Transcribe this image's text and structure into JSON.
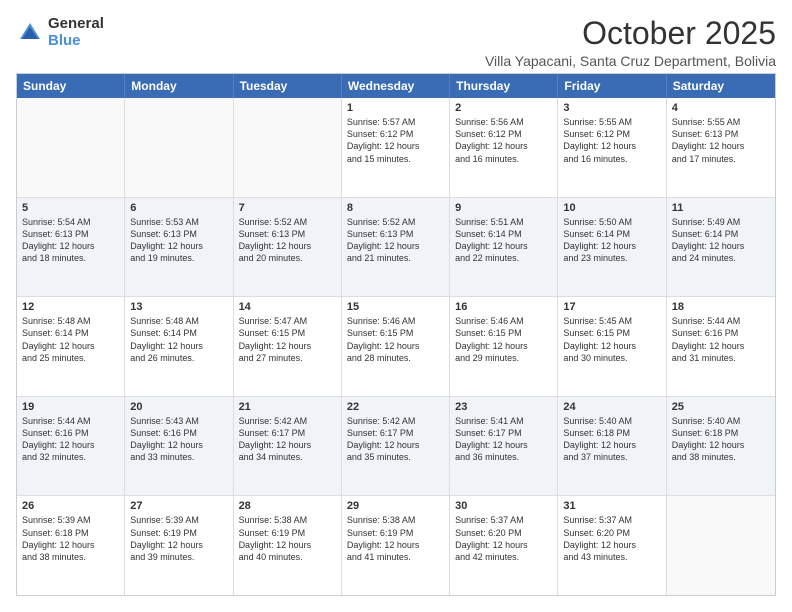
{
  "logo": {
    "general": "General",
    "blue": "Blue"
  },
  "title": "October 2025",
  "location": "Villa Yapacani, Santa Cruz Department, Bolivia",
  "headers": [
    "Sunday",
    "Monday",
    "Tuesday",
    "Wednesday",
    "Thursday",
    "Friday",
    "Saturday"
  ],
  "rows": [
    [
      {
        "day": "",
        "detail": ""
      },
      {
        "day": "",
        "detail": ""
      },
      {
        "day": "",
        "detail": ""
      },
      {
        "day": "1",
        "detail": "Sunrise: 5:57 AM\nSunset: 6:12 PM\nDaylight: 12 hours\nand 15 minutes."
      },
      {
        "day": "2",
        "detail": "Sunrise: 5:56 AM\nSunset: 6:12 PM\nDaylight: 12 hours\nand 16 minutes."
      },
      {
        "day": "3",
        "detail": "Sunrise: 5:55 AM\nSunset: 6:12 PM\nDaylight: 12 hours\nand 16 minutes."
      },
      {
        "day": "4",
        "detail": "Sunrise: 5:55 AM\nSunset: 6:13 PM\nDaylight: 12 hours\nand 17 minutes."
      }
    ],
    [
      {
        "day": "5",
        "detail": "Sunrise: 5:54 AM\nSunset: 6:13 PM\nDaylight: 12 hours\nand 18 minutes."
      },
      {
        "day": "6",
        "detail": "Sunrise: 5:53 AM\nSunset: 6:13 PM\nDaylight: 12 hours\nand 19 minutes."
      },
      {
        "day": "7",
        "detail": "Sunrise: 5:52 AM\nSunset: 6:13 PM\nDaylight: 12 hours\nand 20 minutes."
      },
      {
        "day": "8",
        "detail": "Sunrise: 5:52 AM\nSunset: 6:13 PM\nDaylight: 12 hours\nand 21 minutes."
      },
      {
        "day": "9",
        "detail": "Sunrise: 5:51 AM\nSunset: 6:14 PM\nDaylight: 12 hours\nand 22 minutes."
      },
      {
        "day": "10",
        "detail": "Sunrise: 5:50 AM\nSunset: 6:14 PM\nDaylight: 12 hours\nand 23 minutes."
      },
      {
        "day": "11",
        "detail": "Sunrise: 5:49 AM\nSunset: 6:14 PM\nDaylight: 12 hours\nand 24 minutes."
      }
    ],
    [
      {
        "day": "12",
        "detail": "Sunrise: 5:48 AM\nSunset: 6:14 PM\nDaylight: 12 hours\nand 25 minutes."
      },
      {
        "day": "13",
        "detail": "Sunrise: 5:48 AM\nSunset: 6:14 PM\nDaylight: 12 hours\nand 26 minutes."
      },
      {
        "day": "14",
        "detail": "Sunrise: 5:47 AM\nSunset: 6:15 PM\nDaylight: 12 hours\nand 27 minutes."
      },
      {
        "day": "15",
        "detail": "Sunrise: 5:46 AM\nSunset: 6:15 PM\nDaylight: 12 hours\nand 28 minutes."
      },
      {
        "day": "16",
        "detail": "Sunrise: 5:46 AM\nSunset: 6:15 PM\nDaylight: 12 hours\nand 29 minutes."
      },
      {
        "day": "17",
        "detail": "Sunrise: 5:45 AM\nSunset: 6:15 PM\nDaylight: 12 hours\nand 30 minutes."
      },
      {
        "day": "18",
        "detail": "Sunrise: 5:44 AM\nSunset: 6:16 PM\nDaylight: 12 hours\nand 31 minutes."
      }
    ],
    [
      {
        "day": "19",
        "detail": "Sunrise: 5:44 AM\nSunset: 6:16 PM\nDaylight: 12 hours\nand 32 minutes."
      },
      {
        "day": "20",
        "detail": "Sunrise: 5:43 AM\nSunset: 6:16 PM\nDaylight: 12 hours\nand 33 minutes."
      },
      {
        "day": "21",
        "detail": "Sunrise: 5:42 AM\nSunset: 6:17 PM\nDaylight: 12 hours\nand 34 minutes."
      },
      {
        "day": "22",
        "detail": "Sunrise: 5:42 AM\nSunset: 6:17 PM\nDaylight: 12 hours\nand 35 minutes."
      },
      {
        "day": "23",
        "detail": "Sunrise: 5:41 AM\nSunset: 6:17 PM\nDaylight: 12 hours\nand 36 minutes."
      },
      {
        "day": "24",
        "detail": "Sunrise: 5:40 AM\nSunset: 6:18 PM\nDaylight: 12 hours\nand 37 minutes."
      },
      {
        "day": "25",
        "detail": "Sunrise: 5:40 AM\nSunset: 6:18 PM\nDaylight: 12 hours\nand 38 minutes."
      }
    ],
    [
      {
        "day": "26",
        "detail": "Sunrise: 5:39 AM\nSunset: 6:18 PM\nDaylight: 12 hours\nand 38 minutes."
      },
      {
        "day": "27",
        "detail": "Sunrise: 5:39 AM\nSunset: 6:19 PM\nDaylight: 12 hours\nand 39 minutes."
      },
      {
        "day": "28",
        "detail": "Sunrise: 5:38 AM\nSunset: 6:19 PM\nDaylight: 12 hours\nand 40 minutes."
      },
      {
        "day": "29",
        "detail": "Sunrise: 5:38 AM\nSunset: 6:19 PM\nDaylight: 12 hours\nand 41 minutes."
      },
      {
        "day": "30",
        "detail": "Sunrise: 5:37 AM\nSunset: 6:20 PM\nDaylight: 12 hours\nand 42 minutes."
      },
      {
        "day": "31",
        "detail": "Sunrise: 5:37 AM\nSunset: 6:20 PM\nDaylight: 12 hours\nand 43 minutes."
      },
      {
        "day": "",
        "detail": ""
      }
    ]
  ]
}
